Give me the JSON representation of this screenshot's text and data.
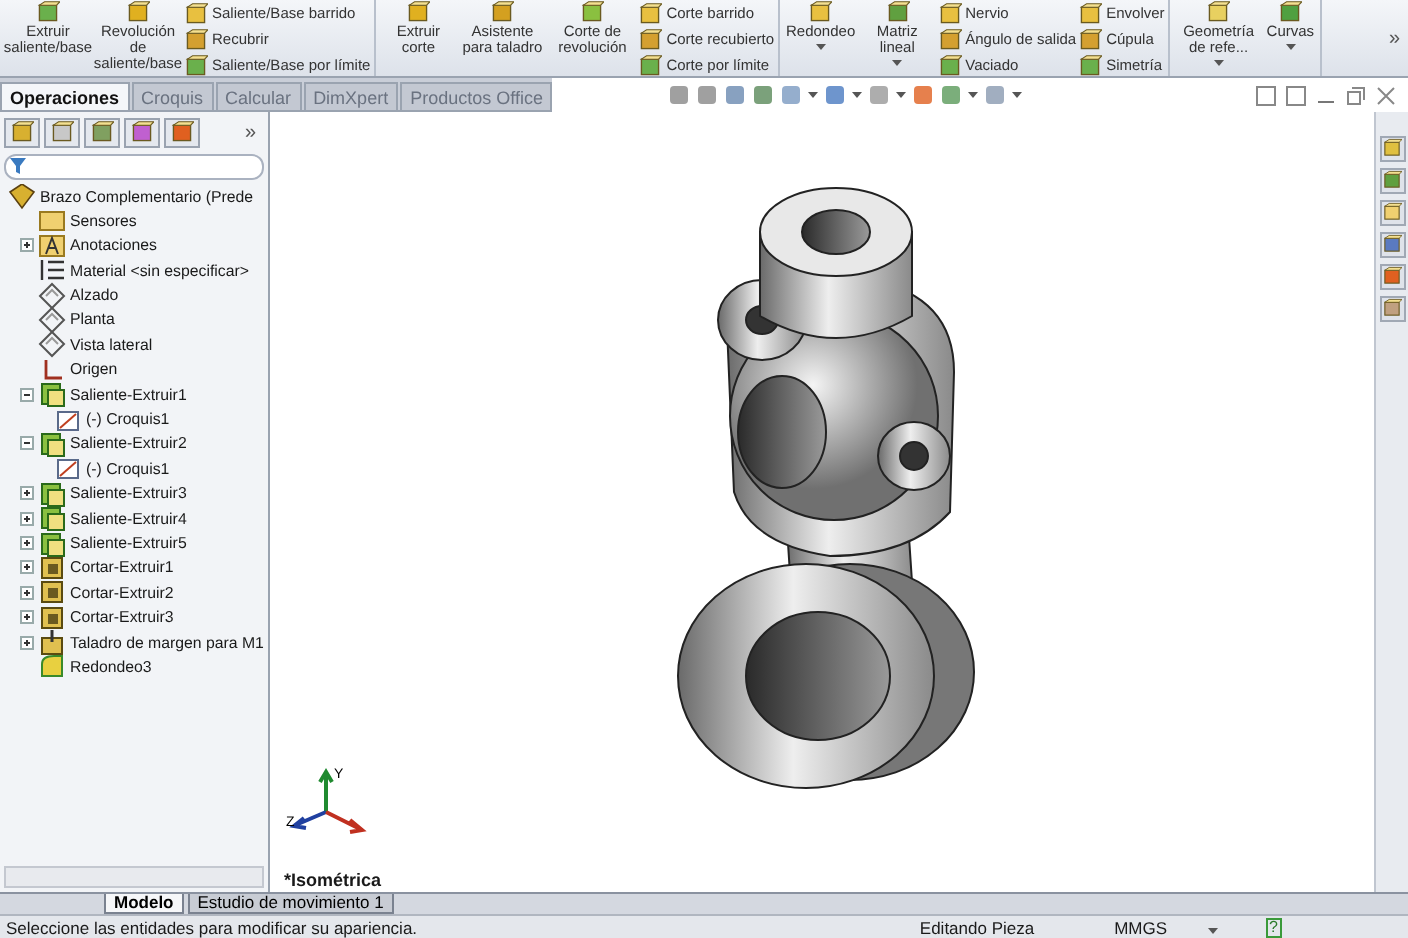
{
  "ribbon": {
    "groups": [
      {
        "items": [
          {
            "kind": "large",
            "label": "Extruir saliente/base",
            "dropdown": false
          },
          {
            "kind": "large",
            "label": "Revolución de saliente/base",
            "dropdown": false
          },
          {
            "kind": "stack",
            "entries": [
              "Saliente/Base barrido",
              "Recubrir",
              "Saliente/Base por límite"
            ]
          }
        ]
      },
      {
        "items": [
          {
            "kind": "large",
            "label": "Extruir corte",
            "dropdown": false
          },
          {
            "kind": "large",
            "label": "Asistente para taladro",
            "dropdown": false
          },
          {
            "kind": "large",
            "label": "Corte de revolución",
            "dropdown": false
          },
          {
            "kind": "stack",
            "entries": [
              "Corte barrido",
              "Corte recubierto",
              "Corte por límite"
            ]
          }
        ]
      },
      {
        "items": [
          {
            "kind": "large",
            "label": "Redondeo",
            "dropdown": true
          },
          {
            "kind": "large",
            "label": "Matriz lineal",
            "dropdown": true
          },
          {
            "kind": "stack",
            "entries": [
              "Nervio",
              "Ángulo de salida",
              "Vaciado"
            ]
          },
          {
            "kind": "stack",
            "entries": [
              "Envolver",
              "Cúpula",
              "Simetría"
            ]
          }
        ]
      },
      {
        "items": [
          {
            "kind": "large",
            "label": "Geometría de refe...",
            "dropdown": true
          },
          {
            "kind": "large",
            "label": "Curvas",
            "dropdown": true
          }
        ]
      }
    ],
    "overflow": "»"
  },
  "tabs": [
    {
      "label": "Operaciones",
      "selected": true
    },
    {
      "label": "Croquis",
      "selected": false
    },
    {
      "label": "Calcular",
      "selected": false
    },
    {
      "label": "DimXpert",
      "selected": false
    },
    {
      "label": "Productos Office",
      "selected": false
    }
  ],
  "panel": {
    "overflow": "»",
    "tree": [
      {
        "label": "Brazo Complementario (Prede",
        "kind": "part",
        "children": [
          {
            "label": "Sensores",
            "kind": "sensors"
          },
          {
            "label": "Anotaciones",
            "kind": "annotations",
            "expanded": false
          },
          {
            "label": "Material <sin especificar>",
            "kind": "material"
          },
          {
            "label": "Alzado",
            "kind": "plane"
          },
          {
            "label": "Planta",
            "kind": "plane"
          },
          {
            "label": "Vista lateral",
            "kind": "plane"
          },
          {
            "label": "Origen",
            "kind": "origin"
          },
          {
            "label": "Saliente-Extruir1",
            "kind": "boss",
            "expanded": true,
            "children": [
              {
                "label": "(-) Croquis1",
                "kind": "sketch"
              }
            ]
          },
          {
            "label": "Saliente-Extruir2",
            "kind": "boss",
            "expanded": true,
            "children": [
              {
                "label": "(-) Croquis1",
                "kind": "sketch"
              }
            ]
          },
          {
            "label": "Saliente-Extruir3",
            "kind": "boss",
            "expanded": false
          },
          {
            "label": "Saliente-Extruir4",
            "kind": "boss",
            "expanded": false
          },
          {
            "label": "Saliente-Extruir5",
            "kind": "boss",
            "expanded": false
          },
          {
            "label": "Cortar-Extruir1",
            "kind": "cut",
            "expanded": false
          },
          {
            "label": "Cortar-Extruir2",
            "kind": "cut",
            "expanded": false
          },
          {
            "label": "Cortar-Extruir3",
            "kind": "cut",
            "expanded": false
          },
          {
            "label": "Taladro de margen para M1",
            "kind": "hole",
            "expanded": false
          },
          {
            "label": "Redondeo3",
            "kind": "fillet"
          }
        ]
      }
    ]
  },
  "viewport": {
    "view_name": "*Isométrica",
    "triad": {
      "y_label": "Y",
      "z_label": "Z"
    }
  },
  "bottom_tabs": [
    {
      "label": "Modelo",
      "selected": true
    },
    {
      "label": "Estudio de movimiento 1",
      "selected": false
    }
  ],
  "status_bar": {
    "message": "Seleccione las entidades para modificar su apariencia.",
    "mode": "Editando Pieza",
    "units": "MMGS",
    "help": "?"
  }
}
